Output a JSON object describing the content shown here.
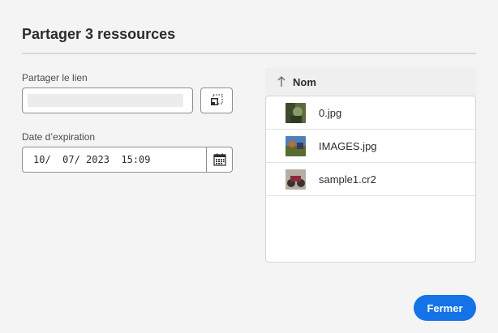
{
  "dialog": {
    "title": "Partager 3 ressources"
  },
  "share_link": {
    "label": "Partager le lien",
    "value": ""
  },
  "expiration": {
    "label": "Date d’expiration",
    "value": "10/  07/ 2023  15:09"
  },
  "file_list": {
    "column_header": "Nom",
    "sort_direction": "ascending",
    "items": [
      {
        "name": "0.jpg"
      },
      {
        "name": "IMAGES.jpg"
      },
      {
        "name": "sample1.cr2"
      }
    ]
  },
  "actions": {
    "close_label": "Fermer"
  },
  "icons": {
    "copy": "copy-icon",
    "calendar": "calendar-icon",
    "sort": "arrow-up-icon"
  },
  "colors": {
    "accent": "#1473e6",
    "background": "#f4f4f4"
  }
}
